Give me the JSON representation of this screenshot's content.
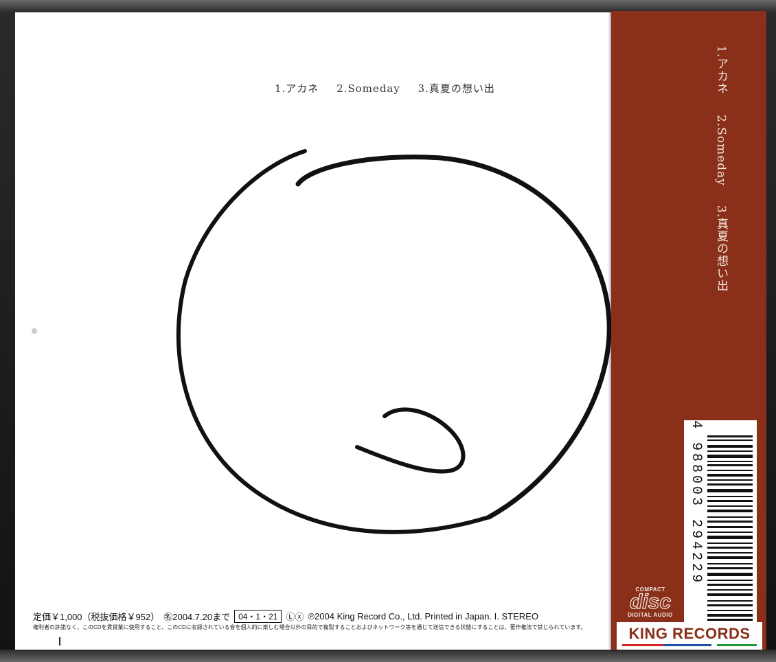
{
  "tracks": [
    "1.アカネ",
    "2.Someday",
    "3.真夏の想い出"
  ],
  "info": {
    "price": "定価￥1,000（税抜価格￥952）",
    "resale": "㊔2004.7.20まで",
    "date_code": "04・1・21",
    "marks": "Ⓛⓧ",
    "copyright": "℗2004 King Record Co., Ltd. Printed in Japan. I. STEREO"
  },
  "notice": "権利者の許諾なく、このCDを賃貸業に使用すること、このCDに収録されている音を個人的に楽しむ場合以外の目的で複製することおよびネットワーク等を通じて送信できる状態にすることは、著作権法で禁じられています。",
  "obi": {
    "tracks": [
      "1.アカネ",
      "2.Someday",
      "3.真夏の想い出"
    ],
    "barcode_number": "4 988003 294229",
    "disc_logo": {
      "top": "COMPACT",
      "word": "disc",
      "bottom": "DIGITAL AUDIO"
    },
    "label": "KING RECORDS",
    "colors": {
      "obi": "#8a2f1a",
      "stripe_red": "#d7261e",
      "stripe_blue": "#1f4fa8",
      "stripe_green": "#1c9a3b"
    }
  }
}
